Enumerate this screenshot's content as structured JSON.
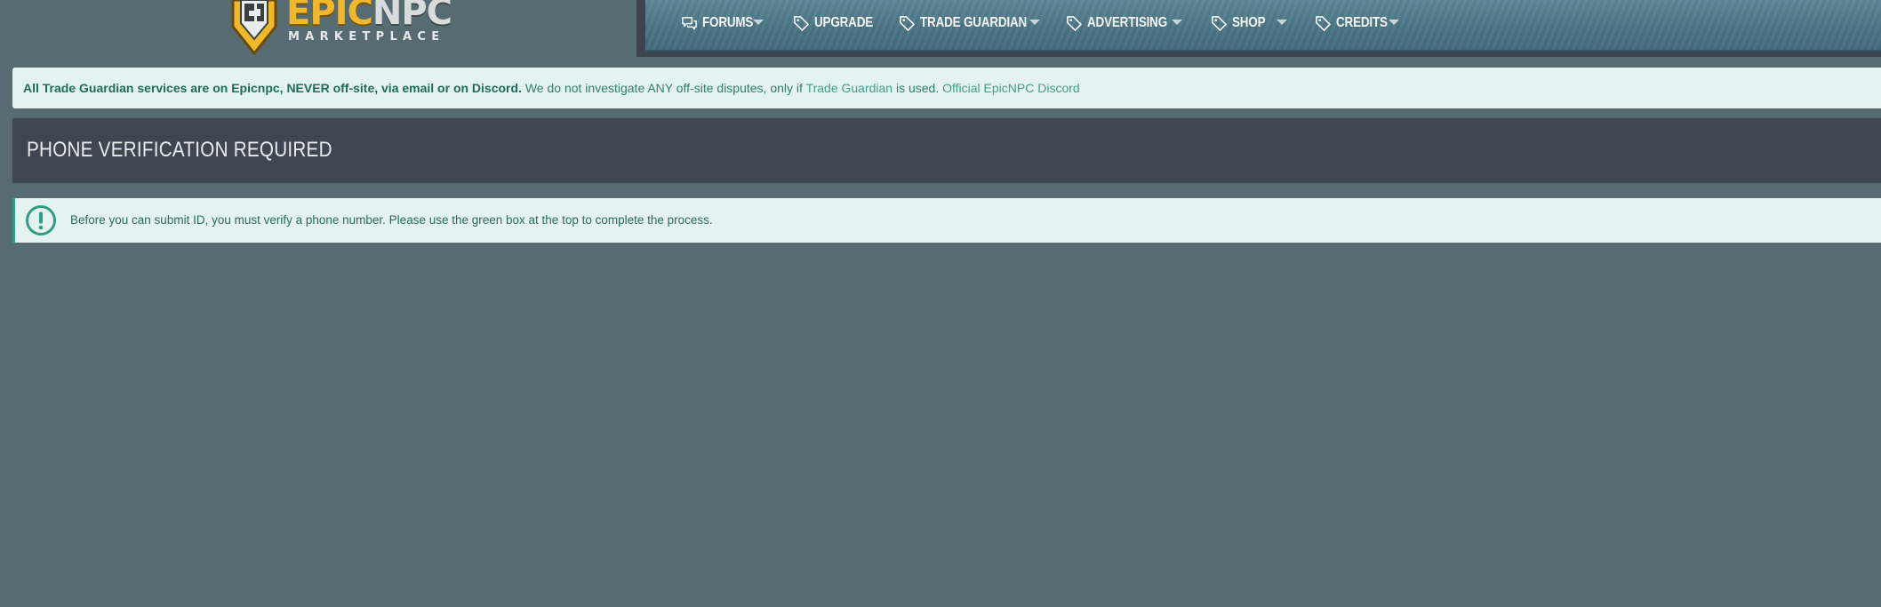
{
  "brand": {
    "name_primary": "EPIC",
    "name_secondary": "NPC",
    "tagline": "MARKETPLACE"
  },
  "nav": {
    "items": [
      {
        "label": "FORUMS",
        "icon": "comments-icon",
        "dropdown": true
      },
      {
        "label": "UPGRADE",
        "icon": "tag-icon",
        "dropdown": false
      },
      {
        "label": "TRADE GUARDIAN",
        "icon": "tag-icon",
        "dropdown": true
      },
      {
        "label": "ADVERTISING",
        "icon": "tag-icon",
        "dropdown": true
      },
      {
        "label": "SHOP",
        "icon": "tag-icon",
        "dropdown": true
      },
      {
        "label": "CREDITS",
        "icon": "tag-icon",
        "dropdown": true
      }
    ]
  },
  "notice": {
    "bold_text": "All Trade Guardian services are on Epicnpc, NEVER off-site, via email or on Discord.",
    "text_1": " We do not investigate ANY off-site disputes, only if ",
    "link_trade_guardian": "Trade Guardian",
    "text_2": " is used. ",
    "link_discord": "Official EpicNPC Discord"
  },
  "page": {
    "title": "PHONE VERIFICATION REQUIRED"
  },
  "alert": {
    "icon": "exclamation-circle-icon",
    "message": "Before you can submit ID, you must verify a phone number. Please use the green box at the top to complete the process."
  },
  "colors": {
    "page_background": "#566c72",
    "navbar": "#4c7584",
    "notice_background": "#e4f3ef",
    "accent_green": "#2f9c84",
    "title_bar": "#3d4651",
    "logo_gold": "#f0b82a"
  }
}
